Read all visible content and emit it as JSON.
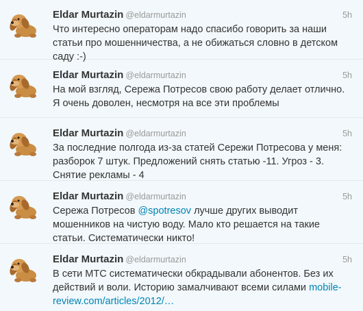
{
  "colors": {
    "background": "#f2f8fb",
    "divider": "#e2e8eb",
    "name": "#333333",
    "muted": "#999999",
    "link": "#0084b4",
    "avatar_dog": "#c98d44"
  },
  "icons": {
    "avatar": "plush-dog-avatar-icon"
  },
  "tweets": [
    {
      "name": "Eldar Murtazin",
      "handle": "@eldarmurtazin",
      "time": "5h",
      "text": {
        "t1": "Что интересно операторам надо спасибо говорить за наши статьи про мошенничества, а не обижаться словно в детском саду :-)"
      }
    },
    {
      "name": "Eldar Murtazin",
      "handle": "@eldarmurtazin",
      "time": "5h",
      "text": {
        "t1": "На мой взгляд, Сережа Потресов свою работу делает отлично. Я очень доволен, несмотря на все эти проблемы"
      }
    },
    {
      "name": "Eldar Murtazin",
      "handle": "@eldarmurtazin",
      "time": "5h",
      "text": {
        "t1": "За последние полгода из-за статей Сережи Потресова у меня: разборок 7 штук. Предложений снять статью -11. Угроз - 3. Снятие рекламы - 4"
      }
    },
    {
      "name": "Eldar Murtazin",
      "handle": "@eldarmurtazin",
      "time": "5h",
      "text": {
        "t1": "Сережа Потресов ",
        "mention": "@spotresov",
        "t2": " лучше других выводит мошенников на чистую воду. Мало кто решается на такие статьи. Систематически никто!"
      }
    },
    {
      "name": "Eldar Murtazin",
      "handle": "@eldarmurtazin",
      "time": "5h",
      "text": {
        "t1": "В сети МТС систематически обкрадывали абонентов. Без их действий и воли. Историю замалчивают всеми силами ",
        "link": "mobile-review.com/articles/2012/…"
      }
    }
  ]
}
